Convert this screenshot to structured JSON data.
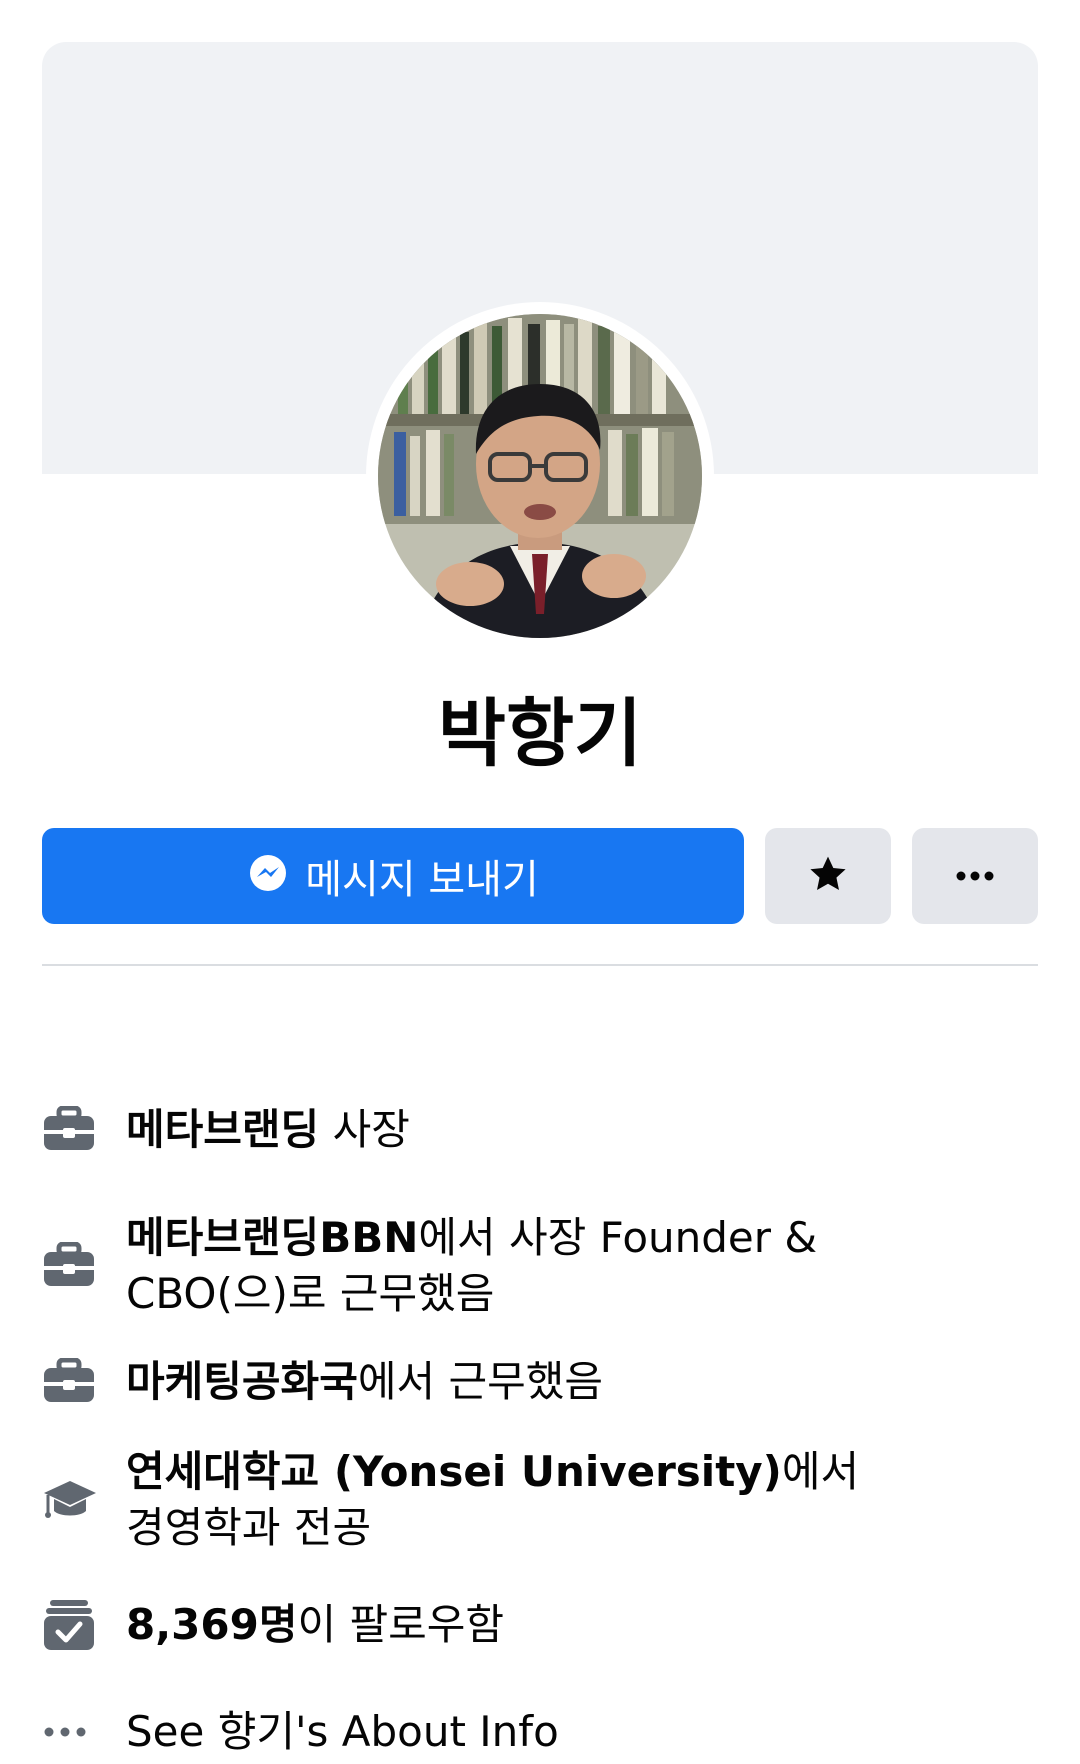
{
  "profile": {
    "name": "박항기"
  },
  "actions": {
    "message_label": "메시지 보내기",
    "favorite_icon": "star-icon",
    "more_icon": "more-dots-icon"
  },
  "details": {
    "current_job": {
      "icon": "briefcase-icon",
      "company": "메타브랜딩",
      "position": "사장"
    },
    "past_job_1": {
      "icon": "briefcase-icon",
      "company": "메타브랜딩BBN",
      "rest_line1": "에서 사장 Founder &",
      "rest_line2": "CBO(으)로 근무했음"
    },
    "past_job_2": {
      "icon": "briefcase-icon",
      "company": "마케팅공화국",
      "rest": "에서 근무했음"
    },
    "education": {
      "icon": "graduation-cap-icon",
      "school": "연세대학교 (Yonsei University)",
      "rest_line1": "에서",
      "rest_line2": "경영학과 전공"
    },
    "followers": {
      "icon": "followers-box-icon",
      "count": "8,369명",
      "rest": "이 팔로우함"
    },
    "about": {
      "icon": "more-dots-icon",
      "text": "See 향기's About Info"
    }
  },
  "colors": {
    "primary": "#1877f2",
    "cover_bg": "#f0f2f5",
    "secondary_button": "#e4e6eb",
    "icon_gray": "#606770",
    "text": "#050505"
  }
}
